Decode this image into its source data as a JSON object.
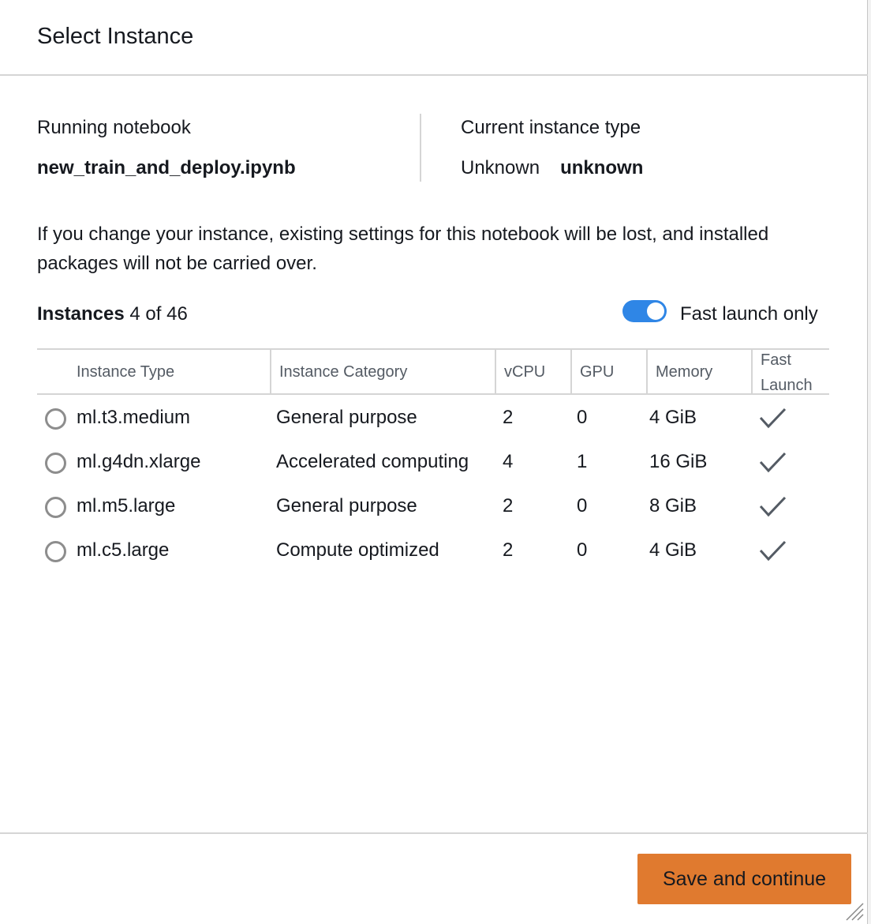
{
  "dialog": {
    "title": "Select Instance"
  },
  "running_notebook": {
    "label": "Running notebook",
    "value": "new_train_and_deploy.ipynb"
  },
  "current_instance": {
    "label": "Current instance type",
    "value": "Unknown",
    "value_bold": "unknown"
  },
  "warning_text": "If you change your instance, existing settings for this notebook will be lost, and installed packages will not be carried over.",
  "instances": {
    "heading": "Instances",
    "count": "4 of 46",
    "fast_launch_toggle": {
      "label": "Fast launch only",
      "on": true
    }
  },
  "table": {
    "headers": {
      "type": "Instance Type",
      "category": "Instance Category",
      "vcpu": "vCPU",
      "gpu": "GPU",
      "memory": "Memory",
      "fast_launch_1": "Fast",
      "fast_launch_2": "Launch"
    },
    "rows": [
      {
        "type": "ml.t3.medium",
        "category": "General purpose",
        "vcpu": "2",
        "gpu": "0",
        "memory": "4 GiB",
        "fast_launch": true
      },
      {
        "type": "ml.g4dn.xlarge",
        "category": "Accelerated computing",
        "vcpu": "4",
        "gpu": "1",
        "memory": "16 GiB",
        "fast_launch": true
      },
      {
        "type": "ml.m5.large",
        "category": "General purpose",
        "vcpu": "2",
        "gpu": "0",
        "memory": "8 GiB",
        "fast_launch": true
      },
      {
        "type": "ml.c5.large",
        "category": "Compute optimized",
        "vcpu": "2",
        "gpu": "0",
        "memory": "4 GiB",
        "fast_launch": true
      }
    ]
  },
  "footer": {
    "primary_button": "Save and continue"
  },
  "colors": {
    "accent_blue": "#2f86e6",
    "button_orange": "#e07a2f",
    "border": "#d5d5d5"
  }
}
